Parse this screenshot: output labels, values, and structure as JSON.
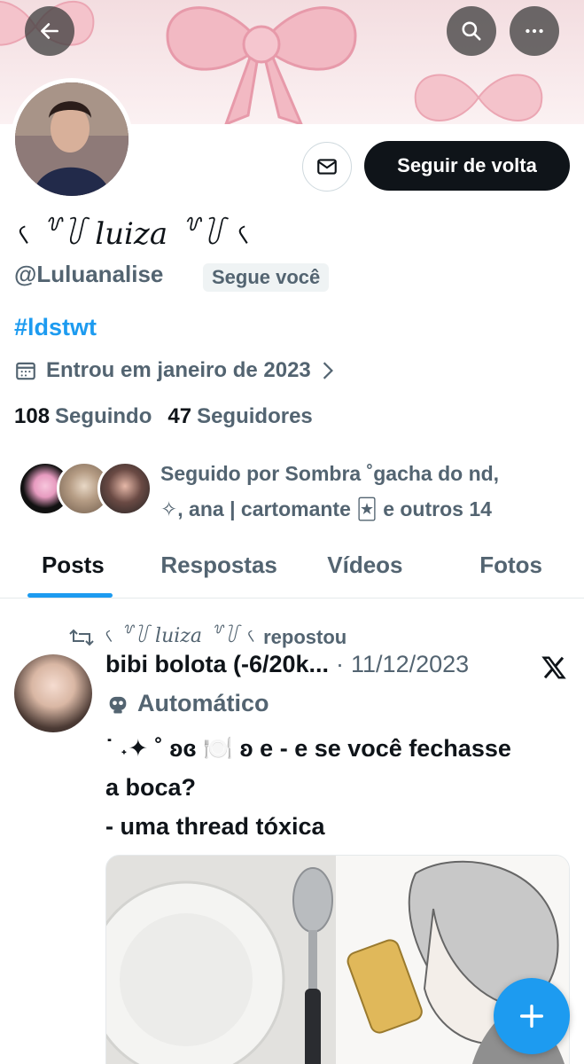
{
  "header": {
    "back_icon": "arrow-left-icon",
    "search_icon": "search-icon",
    "more_icon": "more-horizontal-icon"
  },
  "profile": {
    "display_name": "৻ ꒷꒦ luiza ꒷꒦ ৻",
    "handle": "@Luluanalise",
    "follows_you": "Segue você",
    "follow_back_label": "Seguir de volta",
    "bio": "#ldstwt",
    "joined": "Entrou em janeiro de 2023",
    "following_count": "108",
    "following_label": "Seguindo",
    "followers_count": "47",
    "followers_label": "Seguidores",
    "followed_by_line1": "Seguido por Sombra ˚gacha do nd,",
    "followed_by_line2": "✧, ana | cartomante 🃏 e outros 14"
  },
  "tabs": [
    {
      "label": "Posts",
      "active": true
    },
    {
      "label": "Respostas",
      "active": false
    },
    {
      "label": "Vídeos",
      "active": false
    },
    {
      "label": "Fotos",
      "active": false
    }
  ],
  "post": {
    "repost_name": "৻ ꒷꒦ luiza ꒷꒦ ৻",
    "repost_label": "repostou",
    "author": "bibi bolota (-6/20k...",
    "date_sep": "·",
    "date": "11/12/2023",
    "automated_label": "Automático",
    "text_line1": "˙ ˖✦ ˚ ʚɞ 🍽️ ʚ e - e se você fechasse",
    "text_line2": "a boca?",
    "text_line3": "- uma thread tóxica"
  },
  "colors": {
    "accent": "#1d9bf0",
    "text_primary": "#0f1419",
    "text_secondary": "#536471"
  }
}
